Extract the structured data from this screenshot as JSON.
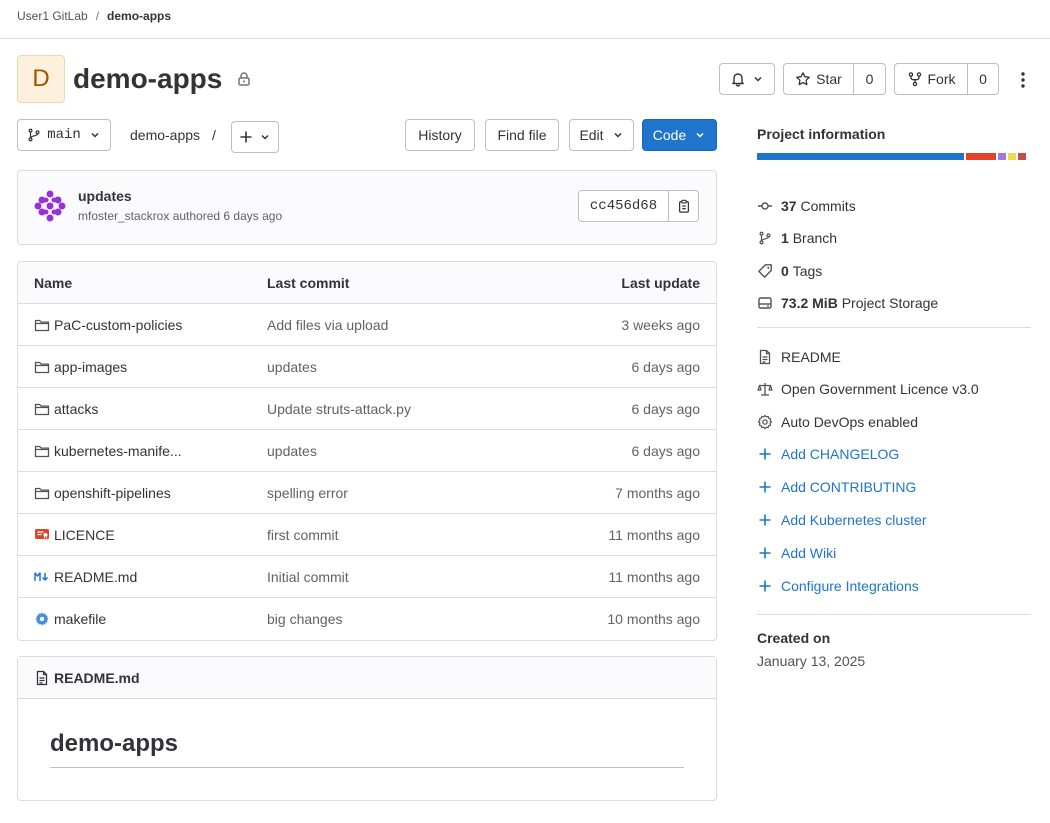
{
  "breadcrumb": {
    "group": "User1 GitLab",
    "project": "demo-apps"
  },
  "project": {
    "avatar_letter": "D",
    "name": "demo-apps"
  },
  "header_actions": {
    "star_label": "Star",
    "star_count": "0",
    "fork_label": "Fork",
    "fork_count": "0"
  },
  "refbar": {
    "branch": "main",
    "path": "demo-apps",
    "path_sep": "/",
    "history_label": "History",
    "find_file_label": "Find file",
    "edit_label": "Edit",
    "code_label": "Code"
  },
  "last_commit": {
    "title": "updates",
    "meta": "mfoster_stackrox authored 6 days ago",
    "sha": "cc456d68"
  },
  "file_table": {
    "headers": {
      "name": "Name",
      "last_commit": "Last commit",
      "last_update": "Last update"
    },
    "rows": [
      {
        "icon": "folder-icon",
        "name": "PaC-custom-policies",
        "commit": "Add files via upload",
        "updated": "3 weeks ago"
      },
      {
        "icon": "folder-icon",
        "name": "app-images",
        "commit": "updates",
        "updated": "6 days ago"
      },
      {
        "icon": "folder-icon",
        "name": "attacks",
        "commit": "Update struts-attack.py",
        "updated": "6 days ago"
      },
      {
        "icon": "folder-icon",
        "name": "kubernetes-manife...",
        "commit": "updates",
        "updated": "6 days ago"
      },
      {
        "icon": "folder-icon",
        "name": "openshift-pipelines",
        "commit": "spelling error",
        "updated": "7 months ago"
      },
      {
        "icon": "licence-icon",
        "name": "LICENCE",
        "commit": "first commit",
        "updated": "11 months ago"
      },
      {
        "icon": "markdown-icon",
        "name": "README.md",
        "commit": "Initial commit",
        "updated": "11 months ago"
      },
      {
        "icon": "settings-file-icon",
        "name": "makefile",
        "commit": "big changes",
        "updated": "10 months ago"
      }
    ]
  },
  "readme": {
    "filename": "README.md",
    "heading": "demo-apps"
  },
  "sidebar": {
    "title": "Project information",
    "language_colors": [
      "#1f75cb",
      "#e24329",
      "#a07bdb",
      "#f0d84f",
      "#c0504d"
    ],
    "language_shares": [
      0.78,
      0.11,
      0.03,
      0.03,
      0.03
    ],
    "stats": {
      "commits_count": "37",
      "commits_label": "Commits",
      "branch_count": "1",
      "branch_label": "Branch",
      "tags_count": "0",
      "tags_label": "Tags",
      "storage_size": "73.2 MiB",
      "storage_label": "Project Storage"
    },
    "info": {
      "readme": "README",
      "licence": "Open Government Licence v3.0",
      "autodevops": "Auto DevOps enabled"
    },
    "add_links": {
      "changelog": "Add CHANGELOG",
      "contributing": "Add CONTRIBUTING",
      "kubernetes": "Add Kubernetes cluster",
      "wiki": "Add Wiki",
      "integrations": "Configure Integrations"
    },
    "created_label": "Created on",
    "created_date": "January 13, 2025"
  }
}
